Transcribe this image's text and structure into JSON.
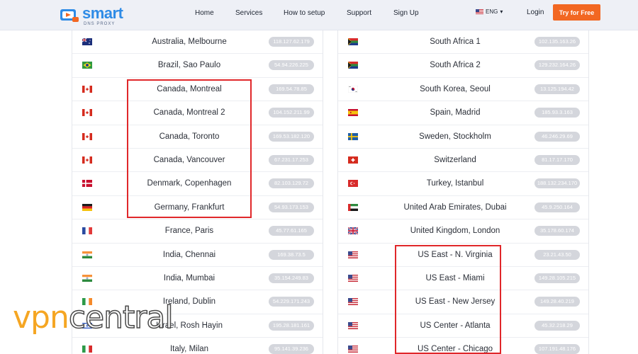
{
  "header": {
    "logo": {
      "name": "smart",
      "sub": "DNS PROXY"
    },
    "nav": [
      "Home",
      "Services",
      "How to setup",
      "Support",
      "Sign Up"
    ],
    "lang": "ENG",
    "login": "Login",
    "cta": "Try for Free"
  },
  "left_rows": [
    {
      "location": "Australia, Melbourne",
      "ip": "118.127.62.179",
      "flag": "au"
    },
    {
      "location": "Brazil, Sao Paulo",
      "ip": "54.94.226.225",
      "flag": "br"
    },
    {
      "location": "Canada, Montreal",
      "ip": "169.54.78.85",
      "flag": "ca"
    },
    {
      "location": "Canada, Montreal 2",
      "ip": "104.152.211.99",
      "flag": "ca"
    },
    {
      "location": "Canada, Toronto",
      "ip": "169.53.182.120",
      "flag": "ca"
    },
    {
      "location": "Canada, Vancouver",
      "ip": "67.231.17.253",
      "flag": "ca"
    },
    {
      "location": "Denmark, Copenhagen",
      "ip": "82.103.129.72",
      "flag": "dk"
    },
    {
      "location": "Germany, Frankfurt",
      "ip": "54.93.173.153",
      "flag": "de"
    },
    {
      "location": "France, Paris",
      "ip": "45.77.61.165",
      "flag": "fr"
    },
    {
      "location": "India, Chennai",
      "ip": "169.38.73.5",
      "flag": "in"
    },
    {
      "location": "India, Mumbai",
      "ip": "35.154.249.83",
      "flag": "in"
    },
    {
      "location": "Ireland, Dublin",
      "ip": "54.229.171.243",
      "flag": "ie"
    },
    {
      "location": "Israel, Rosh Hayin",
      "ip": "195.28.181.161",
      "flag": "il"
    },
    {
      "location": "Italy, Milan",
      "ip": "95.141.39.236",
      "flag": "it"
    }
  ],
  "right_rows": [
    {
      "location": "South Africa 1",
      "ip": "102.135.163.26",
      "flag": "za"
    },
    {
      "location": "South Africa 2",
      "ip": "129.232.164.26",
      "flag": "za"
    },
    {
      "location": "South Korea, Seoul",
      "ip": "13.125.194.42",
      "flag": "kr"
    },
    {
      "location": "Spain, Madrid",
      "ip": "185.93.3.163",
      "flag": "es"
    },
    {
      "location": "Sweden, Stockholm",
      "ip": "46.246.29.69",
      "flag": "se"
    },
    {
      "location": "Switzerland",
      "ip": "81.17.17.170",
      "flag": "ch"
    },
    {
      "location": "Turkey, Istanbul",
      "ip": "188.132.234.170",
      "flag": "tr"
    },
    {
      "location": "United Arab Emirates, Dubai",
      "ip": "45.9.250.164",
      "flag": "ae"
    },
    {
      "location": "United Kingdom, London",
      "ip": "35.178.60.174",
      "flag": "gb"
    },
    {
      "location": "US East - N. Virginia",
      "ip": "23.21.43.50",
      "flag": "us"
    },
    {
      "location": "US East - Miami",
      "ip": "149.28.105.215",
      "flag": "us"
    },
    {
      "location": "US East - New Jersey",
      "ip": "149.28.40.219",
      "flag": "us"
    },
    {
      "location": "US Center - Atlanta",
      "ip": "45.32.218.29",
      "flag": "us"
    },
    {
      "location": "US Center - Chicago",
      "ip": "107.191.48.176",
      "flag": "us"
    }
  ],
  "watermark": {
    "part1": "vpn",
    "part2": "central"
  },
  "colors": {
    "accent": "#f26722",
    "brand": "#2e8be6",
    "highlight": "#e0272a",
    "ip_badge": "#d4d6dc"
  }
}
